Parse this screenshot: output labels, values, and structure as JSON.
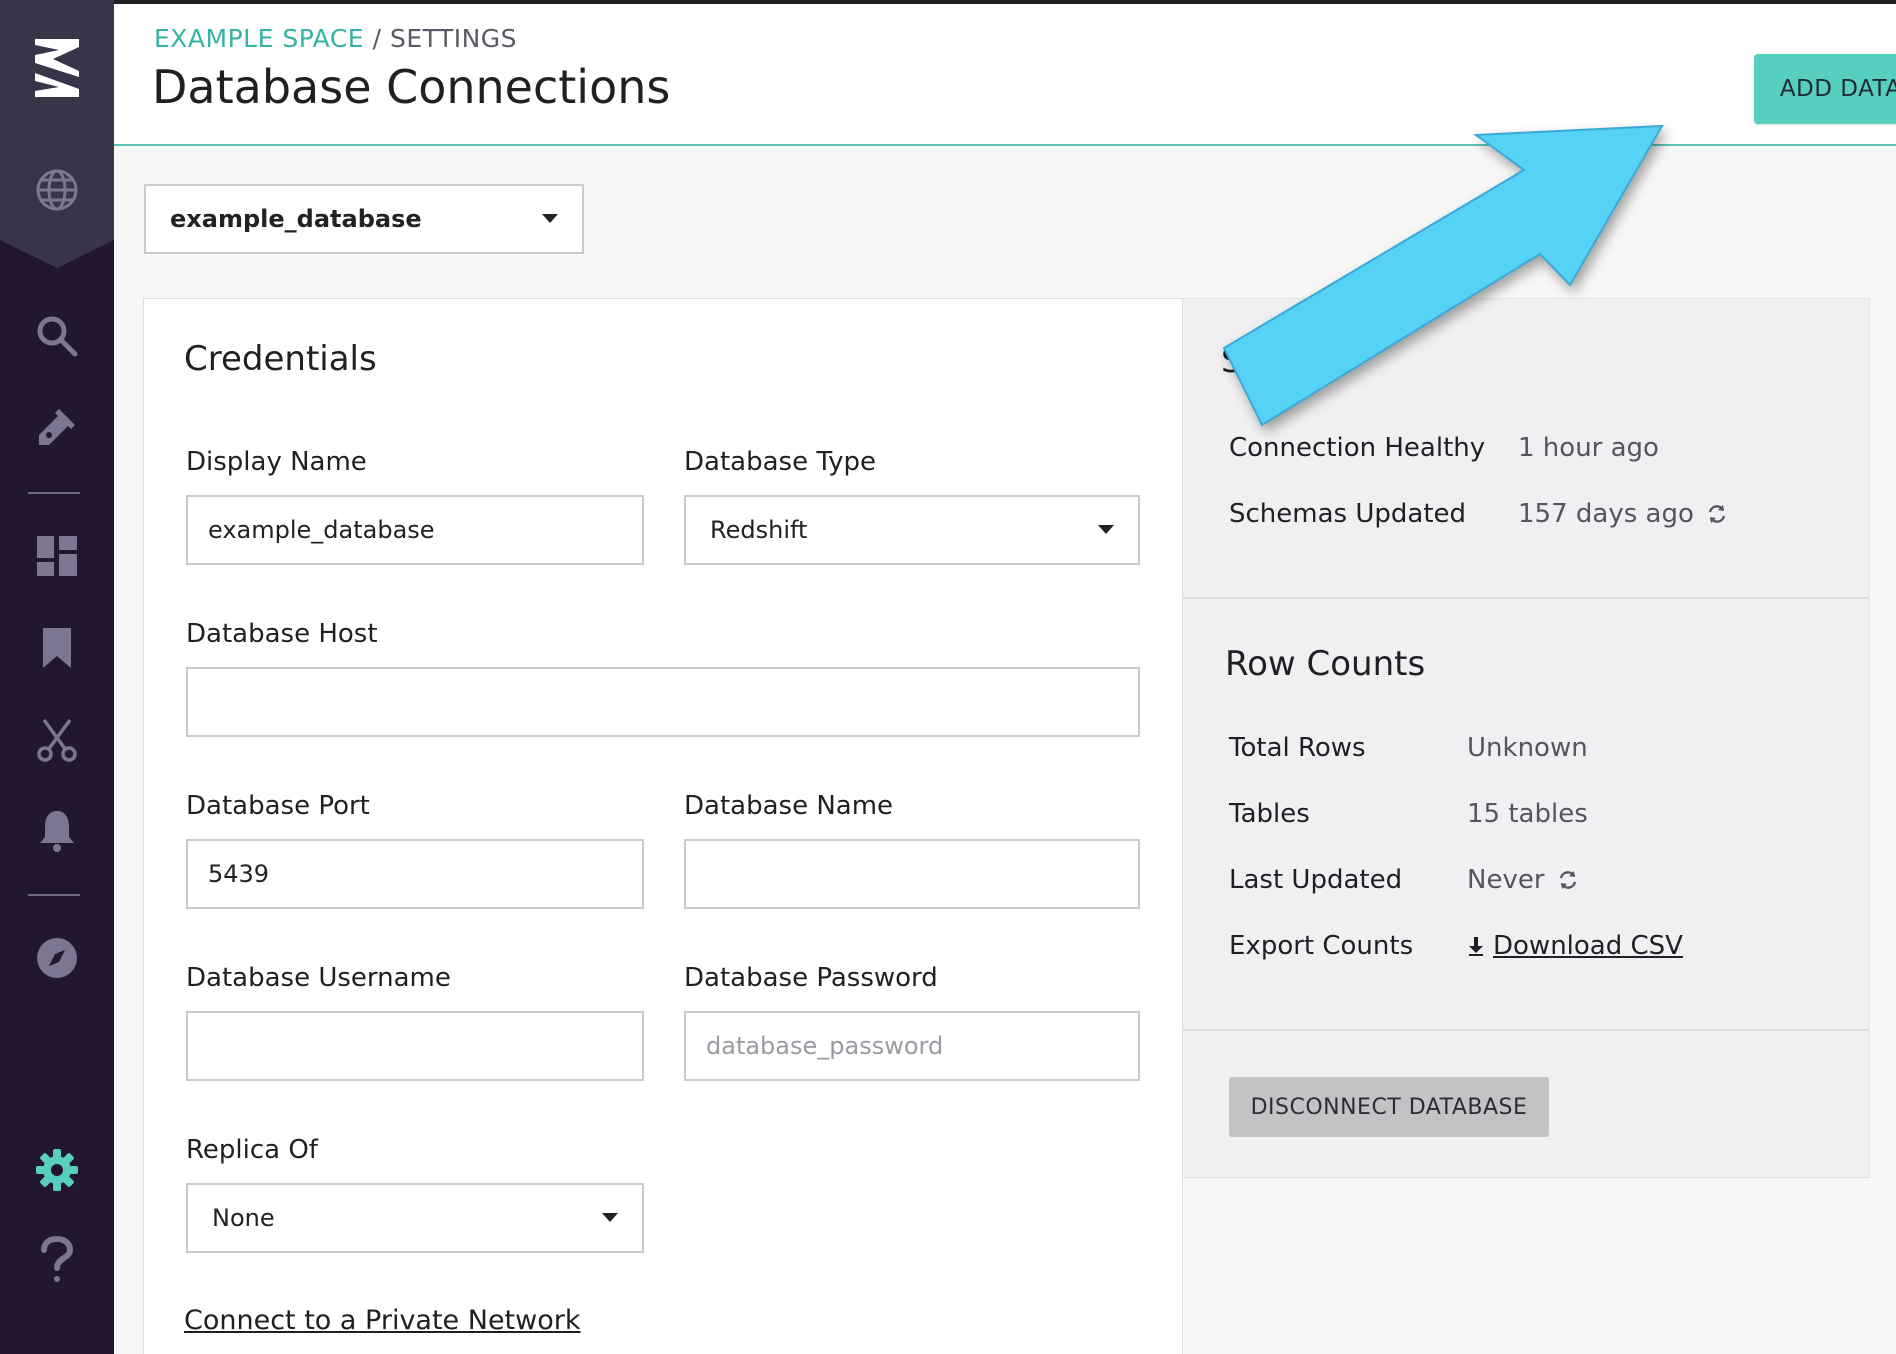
{
  "header": {
    "breadcrumb_space": "EXAMPLE SPACE",
    "breadcrumb_sep": "/",
    "breadcrumb_settings": "SETTINGS",
    "title": "Database Connections",
    "add_button": "ADD DATABASE"
  },
  "db_selector": {
    "value": "example_database"
  },
  "credentials": {
    "title": "Credentials",
    "display_name_label": "Display Name",
    "display_name_value": "example_database",
    "db_type_label": "Database Type",
    "db_type_value": "Redshift",
    "host_label": "Database Host",
    "host_value": "",
    "port_label": "Database Port",
    "port_value": "5439",
    "db_name_label": "Database Name",
    "db_name_value": "",
    "username_label": "Database Username",
    "username_value": "",
    "password_label": "Database Password",
    "password_placeholder": "database_password",
    "replica_label": "Replica Of",
    "replica_value": "None",
    "private_network_link": "Connect to a Private Network"
  },
  "status": {
    "title": "S",
    "connection_label": "Connection Healthy",
    "connection_value": "1 hour ago",
    "schemas_label": "Schemas Updated",
    "schemas_value": "157 days ago"
  },
  "row_counts": {
    "title": "Row Counts",
    "total_rows_label": "Total Rows",
    "total_rows_value": "Unknown",
    "tables_label": "Tables",
    "tables_value": "15 tables",
    "last_updated_label": "Last Updated",
    "last_updated_value": "Never",
    "export_label": "Export Counts",
    "download_link": "Download CSV"
  },
  "disconnect_button": "DISCONNECT DATABASE",
  "colors": {
    "sidebar": "#231630",
    "accent": "#56cfbf",
    "arrow": "#56d2f7"
  },
  "sidebar_icons": [
    "logo-icon",
    "globe-icon",
    "search-icon",
    "tag-icon",
    "dashboard-icon",
    "bookmark-icon",
    "scissors-icon",
    "bell-icon",
    "compass-icon",
    "gear-icon",
    "help-icon"
  ]
}
